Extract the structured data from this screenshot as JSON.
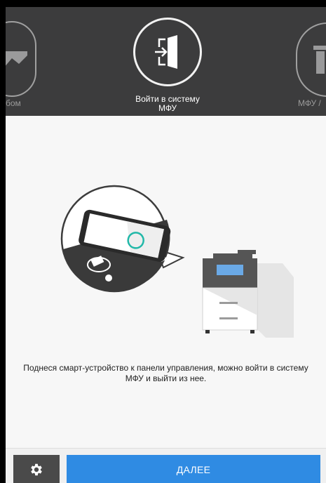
{
  "carousel": {
    "left_label": "бом",
    "center_label_line1": "Войти в систему",
    "center_label_line2": "МФУ",
    "right_label": "МФУ /"
  },
  "main": {
    "instruction_line1": "Поднеся смарт-устройство к панели управления, можно войти в систему",
    "instruction_line2": "МФУ и выйти из нее."
  },
  "bottom": {
    "next_label": "ДАЛЕЕ"
  },
  "colors": {
    "carousel_bg": "#3c3c3d",
    "accent_blue": "#2f8be3",
    "settings_bg": "#4a4a4a"
  }
}
